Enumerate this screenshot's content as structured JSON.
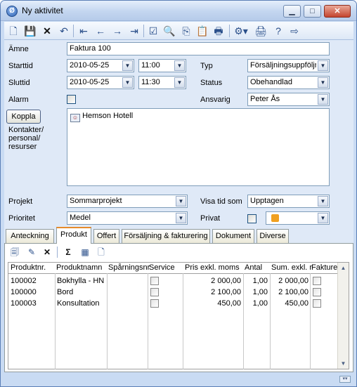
{
  "window": {
    "title": "Ny aktivitet",
    "app_icon_glyph": "Ø"
  },
  "toolbar": {
    "icons": [
      "new-document-icon",
      "save-icon",
      "delete-icon",
      "undo-icon",
      "first-record-icon",
      "previous-record-icon",
      "next-record-icon",
      "last-record-icon",
      "checkmark-icon",
      "preview-icon",
      "copy-icon",
      "copy-special-icon",
      "print-preview-icon",
      "properties-dropdown-icon",
      "print-icon",
      "help-icon",
      "exit-icon"
    ]
  },
  "form": {
    "amne_label": "Ämne",
    "amne_value": "Faktura 100",
    "starttid_label": "Starttid",
    "start_date": "2010-05-25",
    "start_time": "11:00",
    "sluttid_label": "Sluttid",
    "end_date": "2010-05-25",
    "end_time": "11:30",
    "alarm_label": "Alarm",
    "typ_label": "Typ",
    "typ_value": "Försäljningsuppföljni",
    "status_label": "Status",
    "status_value": "Obehandlad",
    "ansvarig_label": "Ansvarig",
    "ansvarig_value": "Peter Ås",
    "koppla_label": "Koppla",
    "kontakter_label": "Kontakter/\npersonal/\nresurser",
    "contact_item": "Hemson Hotell",
    "projekt_label": "Projekt",
    "projekt_value": "Sommarprojekt",
    "visa_tid_label": "Visa tid som",
    "visa_tid_value": "Upptagen",
    "prioritet_label": "Prioritet",
    "prioritet_value": "Medel",
    "privat_label": "Privat",
    "color_value": "#f0a020"
  },
  "tabs": [
    "Anteckning",
    "Produkt",
    "Offert",
    "Försäljning & fakturering",
    "Dokument",
    "Diverse"
  ],
  "active_tab": "Produkt",
  "product_toolbar": {
    "sum_glyph": "Σ"
  },
  "grid": {
    "columns": [
      "Produktnr.",
      "Produktnamn",
      "Spårningsnr.",
      "Service",
      "Pris exkl. moms",
      "Antal",
      "Sum. exkl. m",
      "Fakture"
    ],
    "rows": [
      {
        "nr": "100002",
        "name": "Bokhylla - HN",
        "price": "2 000,00",
        "qty": "1,00",
        "sum": "2 000,00"
      },
      {
        "nr": "100000",
        "name": "Bord",
        "price": "2 100,00",
        "qty": "1,00",
        "sum": "2 100,00"
      },
      {
        "nr": "100003",
        "name": "Konsultation",
        "price": "450,00",
        "qty": "1,00",
        "sum": "450,00"
      }
    ]
  }
}
